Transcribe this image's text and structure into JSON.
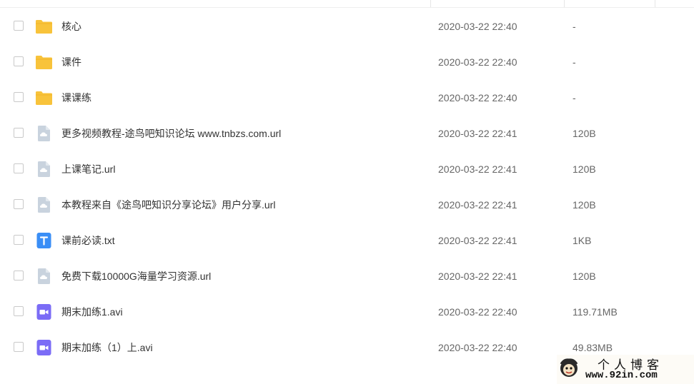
{
  "file_list": {
    "rows": [
      {
        "icon": "folder-icon",
        "name": "核心",
        "date": "2020-03-22 22:40",
        "size": "-"
      },
      {
        "icon": "folder-icon",
        "name": "课件",
        "date": "2020-03-22 22:40",
        "size": "-"
      },
      {
        "icon": "folder-icon",
        "name": "课课练",
        "date": "2020-03-22 22:40",
        "size": "-"
      },
      {
        "icon": "link-file-icon",
        "name": "更多视频教程-途鸟吧知识论坛 www.tnbzs.com.url",
        "date": "2020-03-22 22:41",
        "size": "120B"
      },
      {
        "icon": "link-file-icon",
        "name": "上课笔记.url",
        "date": "2020-03-22 22:41",
        "size": "120B"
      },
      {
        "icon": "link-file-icon",
        "name": "本教程来自《途鸟吧知识分享论坛》用户分享.url",
        "date": "2020-03-22 22:41",
        "size": "120B"
      },
      {
        "icon": "text-file-icon",
        "name": "课前必读.txt",
        "date": "2020-03-22 22:41",
        "size": "1KB"
      },
      {
        "icon": "link-file-icon",
        "name": "免费下载10000G海量学习资源.url",
        "date": "2020-03-22 22:41",
        "size": "120B"
      },
      {
        "icon": "video-file-icon",
        "name": "期末加练1.avi",
        "date": "2020-03-22 22:40",
        "size": "119.71MB"
      },
      {
        "icon": "video-file-icon",
        "name": "期末加练（1）上.avi",
        "date": "2020-03-22 22:40",
        "size": "49.83MB"
      }
    ]
  },
  "watermark": {
    "title": "个人博客",
    "url": "www.92in.com"
  },
  "colors": {
    "folder": "#f8c33b",
    "link_file": "#c9d3de",
    "text_file": "#3a8ef6",
    "video_file": "#7b6cf6",
    "checkbox_border": "#c9c9c9"
  }
}
